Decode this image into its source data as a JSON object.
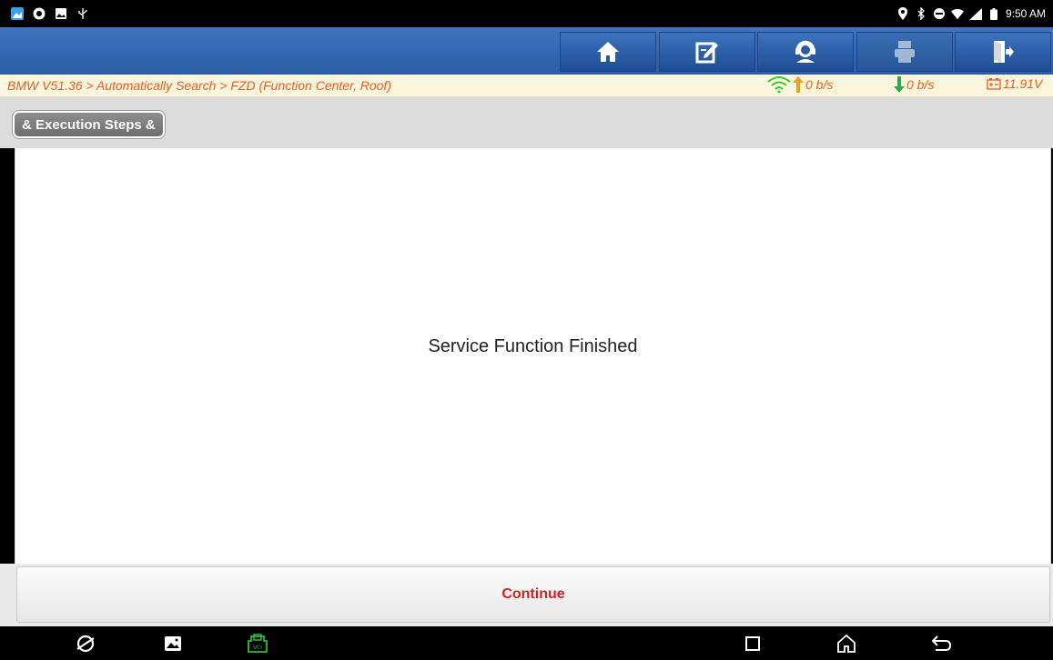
{
  "status_bar": {
    "time": "9:50 AM",
    "left_icons": [
      "gallery-app-icon",
      "browser-icon",
      "photo-icon",
      "usb-icon"
    ],
    "right_icons": [
      "location-icon",
      "bluetooth-icon",
      "dnd-icon",
      "wifi-icon",
      "signal-icon",
      "battery-icon"
    ]
  },
  "toolbar": {
    "buttons": [
      {
        "name": "home",
        "icon": "home-icon"
      },
      {
        "name": "edit",
        "icon": "edit-icon"
      },
      {
        "name": "support",
        "icon": "support-icon"
      },
      {
        "name": "print",
        "icon": "print-icon",
        "enabled": false
      },
      {
        "name": "exit",
        "icon": "exit-icon"
      }
    ]
  },
  "breadcrumb": {
    "path": "BMW V51.36 > Automatically Search > FZD (Function Center, Roof)",
    "upload_rate": "0 b/s",
    "download_rate": "0 b/s",
    "voltage": "11.91V"
  },
  "section": {
    "title": "& Execution Steps &"
  },
  "content": {
    "message": "Service Function Finished"
  },
  "actions": {
    "continue_label": "Continue"
  },
  "nav_bar": {
    "icons": [
      "browser-icon",
      "gallery-icon",
      "vci-icon",
      "recents-icon",
      "home-icon",
      "back-icon"
    ]
  },
  "colors": {
    "toolbar_blue": "#2f62ac",
    "breadcrumb_text": "#f05a1a",
    "continue_text": "#d62020",
    "upload_arrow": "#f0a020",
    "download_arrow": "#2ea84a",
    "wifi_green": "#33cc33"
  }
}
